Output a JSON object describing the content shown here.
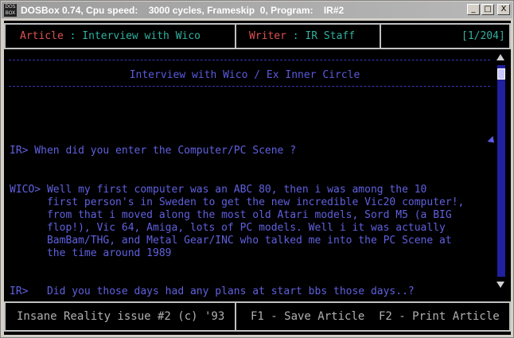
{
  "window": {
    "icon_text": "DOS BOX",
    "title": "DOSBox 0.74, Cpu speed:    3000 cycles, Frameskip  0, Program:    IR#2",
    "minimize_glyph": "_",
    "maximize_glyph": "□",
    "close_glyph": "X"
  },
  "header": {
    "article_label": "Article",
    "article_sep": " : ",
    "article_value": "Interview with Wico",
    "writer_label": "Writer",
    "writer_sep": " : ",
    "writer_value": "IR Staff",
    "page_indicator": "[1/204]"
  },
  "article": {
    "title": "Interview with Wico / Ex Inner Circle",
    "lines": [
      "IR> When did you enter the Computer/PC Scene ?",
      "WICO> Well my first computer was an ABC 80, then i was among the 10",
      "      first person's in Sweden to get the new incredible Vic20 computer!,",
      "      from that i moved along the most old Atari models, Sord M5 (a BIG",
      "      flop!), Vic 64, Amiga, lots of PC models. Well i it was actually",
      "      BamBam/THG, and Metal Gear/INC who talked me into the PC Scene at",
      "      the time around 1989",
      "IR>   Did you those days had any plans at start bbs those days..?"
    ]
  },
  "footer": {
    "issue": "Insane Reality issue #2 (c) '93",
    "f1": "F1 - Save Article",
    "f2": "F2 - Print Article"
  },
  "scrollbar": {
    "position": 0.0
  },
  "colors": {
    "screen_bg": "#000000",
    "text_blue": "#6060e0",
    "label_red": "#e05050",
    "value_cyan": "#30b0a0",
    "scroll_track": "#2020a0"
  }
}
